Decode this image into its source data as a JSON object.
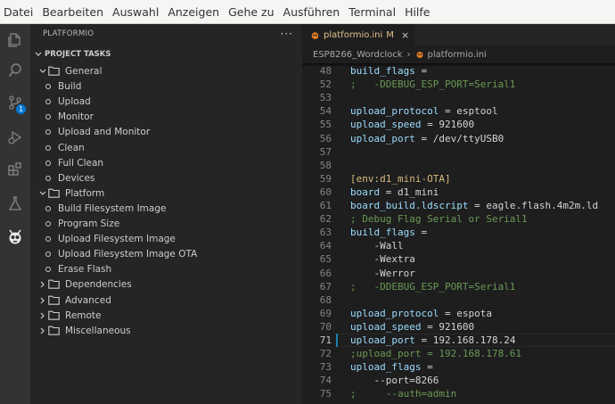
{
  "menubar": {
    "items": [
      "Datei",
      "Bearbeiten",
      "Auswahl",
      "Anzeigen",
      "Gehe zu",
      "Ausführen",
      "Terminal",
      "Hilfe"
    ]
  },
  "activitybar": {
    "icons": [
      "explorer-icon",
      "search-icon",
      "source-control-icon",
      "run-debug-icon",
      "extensions-icon",
      "testing-icon",
      "platformio-icon"
    ],
    "scm_badge": "1"
  },
  "sidebar": {
    "title": "PLATFORMIO",
    "more": "···",
    "section": "PROJECT TASKS",
    "tree": [
      {
        "label": "General",
        "type": "folder",
        "expanded": true
      },
      {
        "label": "Build",
        "type": "task"
      },
      {
        "label": "Upload",
        "type": "task"
      },
      {
        "label": "Monitor",
        "type": "task"
      },
      {
        "label": "Upload and Monitor",
        "type": "task"
      },
      {
        "label": "Clean",
        "type": "task"
      },
      {
        "label": "Full Clean",
        "type": "task"
      },
      {
        "label": "Devices",
        "type": "task"
      },
      {
        "label": "Platform",
        "type": "folder",
        "expanded": true
      },
      {
        "label": "Build Filesystem Image",
        "type": "task"
      },
      {
        "label": "Program Size",
        "type": "task"
      },
      {
        "label": "Upload Filesystem Image",
        "type": "task"
      },
      {
        "label": "Upload Filesystem Image OTA",
        "type": "task"
      },
      {
        "label": "Erase Flash",
        "type": "task"
      },
      {
        "label": "Dependencies",
        "type": "folder",
        "expanded": false
      },
      {
        "label": "Advanced",
        "type": "folder",
        "expanded": false
      },
      {
        "label": "Remote",
        "type": "folder",
        "expanded": false
      },
      {
        "label": "Miscellaneous",
        "type": "folder",
        "expanded": false
      }
    ]
  },
  "editor": {
    "tab": {
      "label": "platformio.ini",
      "modified": "M",
      "close": "×"
    },
    "breadcrumbs": [
      "ESP8266_Wordclock",
      "platformio.ini"
    ],
    "active_line": "71",
    "lines": [
      {
        "n": "48",
        "t": "build_flags ="
      },
      {
        "n": "52",
        "t": ";   -DDEBUG_ESP_PORT=Serial1"
      },
      {
        "n": "53",
        "t": ""
      },
      {
        "n": "54",
        "t": "upload_protocol = esptool"
      },
      {
        "n": "55",
        "t": "upload_speed = 921600"
      },
      {
        "n": "56",
        "t": "upload_port = /dev/ttyUSB0"
      },
      {
        "n": "57",
        "t": ""
      },
      {
        "n": "58",
        "t": ""
      },
      {
        "n": "59",
        "t": "[env:d1_mini-OTA]"
      },
      {
        "n": "60",
        "t": "board = d1_mini"
      },
      {
        "n": "61",
        "t": "board_build.ldscript = eagle.flash.4m2m.ld"
      },
      {
        "n": "62",
        "t": "; Debug Flag Serial or Serial1"
      },
      {
        "n": "63",
        "t": "build_flags ="
      },
      {
        "n": "64",
        "t": "    -Wall"
      },
      {
        "n": "65",
        "t": "    -Wextra"
      },
      {
        "n": "66",
        "t": "    -Werror"
      },
      {
        "n": "67",
        "t": ";   -DDEBUG_ESP_PORT=Serial1"
      },
      {
        "n": "68",
        "t": ""
      },
      {
        "n": "69",
        "t": "upload_protocol = espota"
      },
      {
        "n": "70",
        "t": "upload_speed = 921600"
      },
      {
        "n": "71",
        "t": "upload_port = 192.168.178.24"
      },
      {
        "n": "72",
        "t": ";upload_port = 192.168.178.61"
      },
      {
        "n": "73",
        "t": "upload_flags ="
      },
      {
        "n": "74",
        "t": "    --port=8266"
      },
      {
        "n": "75",
        "t": ";     --auth=admin"
      }
    ]
  },
  "colors": {
    "activitybar": "#333333",
    "sidebar": "#252526",
    "editor": "#1e1e1e",
    "key": "#9cdcfe",
    "comment": "#6a9955",
    "section": "#d7ba7d",
    "tab_modified": "#e2c08d",
    "badge": "#0078d4"
  }
}
